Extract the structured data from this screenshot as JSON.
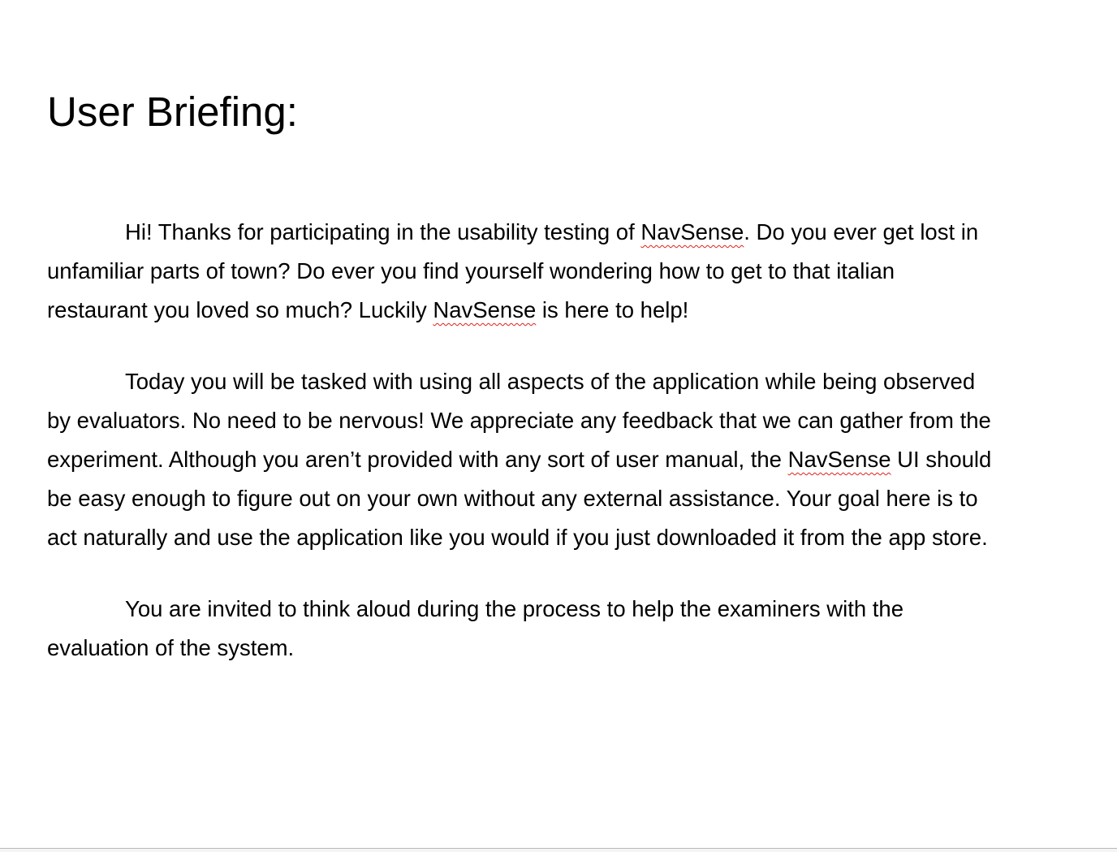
{
  "document": {
    "title": "User Briefing:",
    "misspelled_color": "#e0201a",
    "paragraphs": [
      {
        "lines": [
          [
            "Hi! Thanks for participating in the usability testing of ",
            {
              "spell": "NavSense"
            },
            ". Do you ever get lost in"
          ],
          [
            "unfamiliar parts of town? Do ever you find yourself wondering how to get to that italian"
          ],
          [
            "restaurant you loved so much? Luckily ",
            {
              "spell": "NavSense"
            },
            " is here to help!"
          ]
        ]
      },
      {
        "lines": [
          [
            "Today you will be tasked with using all aspects of the application while being observed"
          ],
          [
            "by evaluators. No need to be nervous! We appreciate any feedback that we can gather from the"
          ],
          [
            "experiment. Although you aren’t provided with any sort of user manual, the ",
            {
              "spell": "NavSense"
            },
            " UI should"
          ],
          [
            "be easy enough to figure out on your own without any external assistance. Your goal here is to"
          ],
          [
            "act naturally and use the application like you would if you just downloaded it from the app store."
          ]
        ]
      },
      {
        "lines": [
          [
            "You are invited to think aloud during the process to help the examiners with the"
          ],
          [
            "evaluation of the system."
          ]
        ]
      }
    ]
  }
}
